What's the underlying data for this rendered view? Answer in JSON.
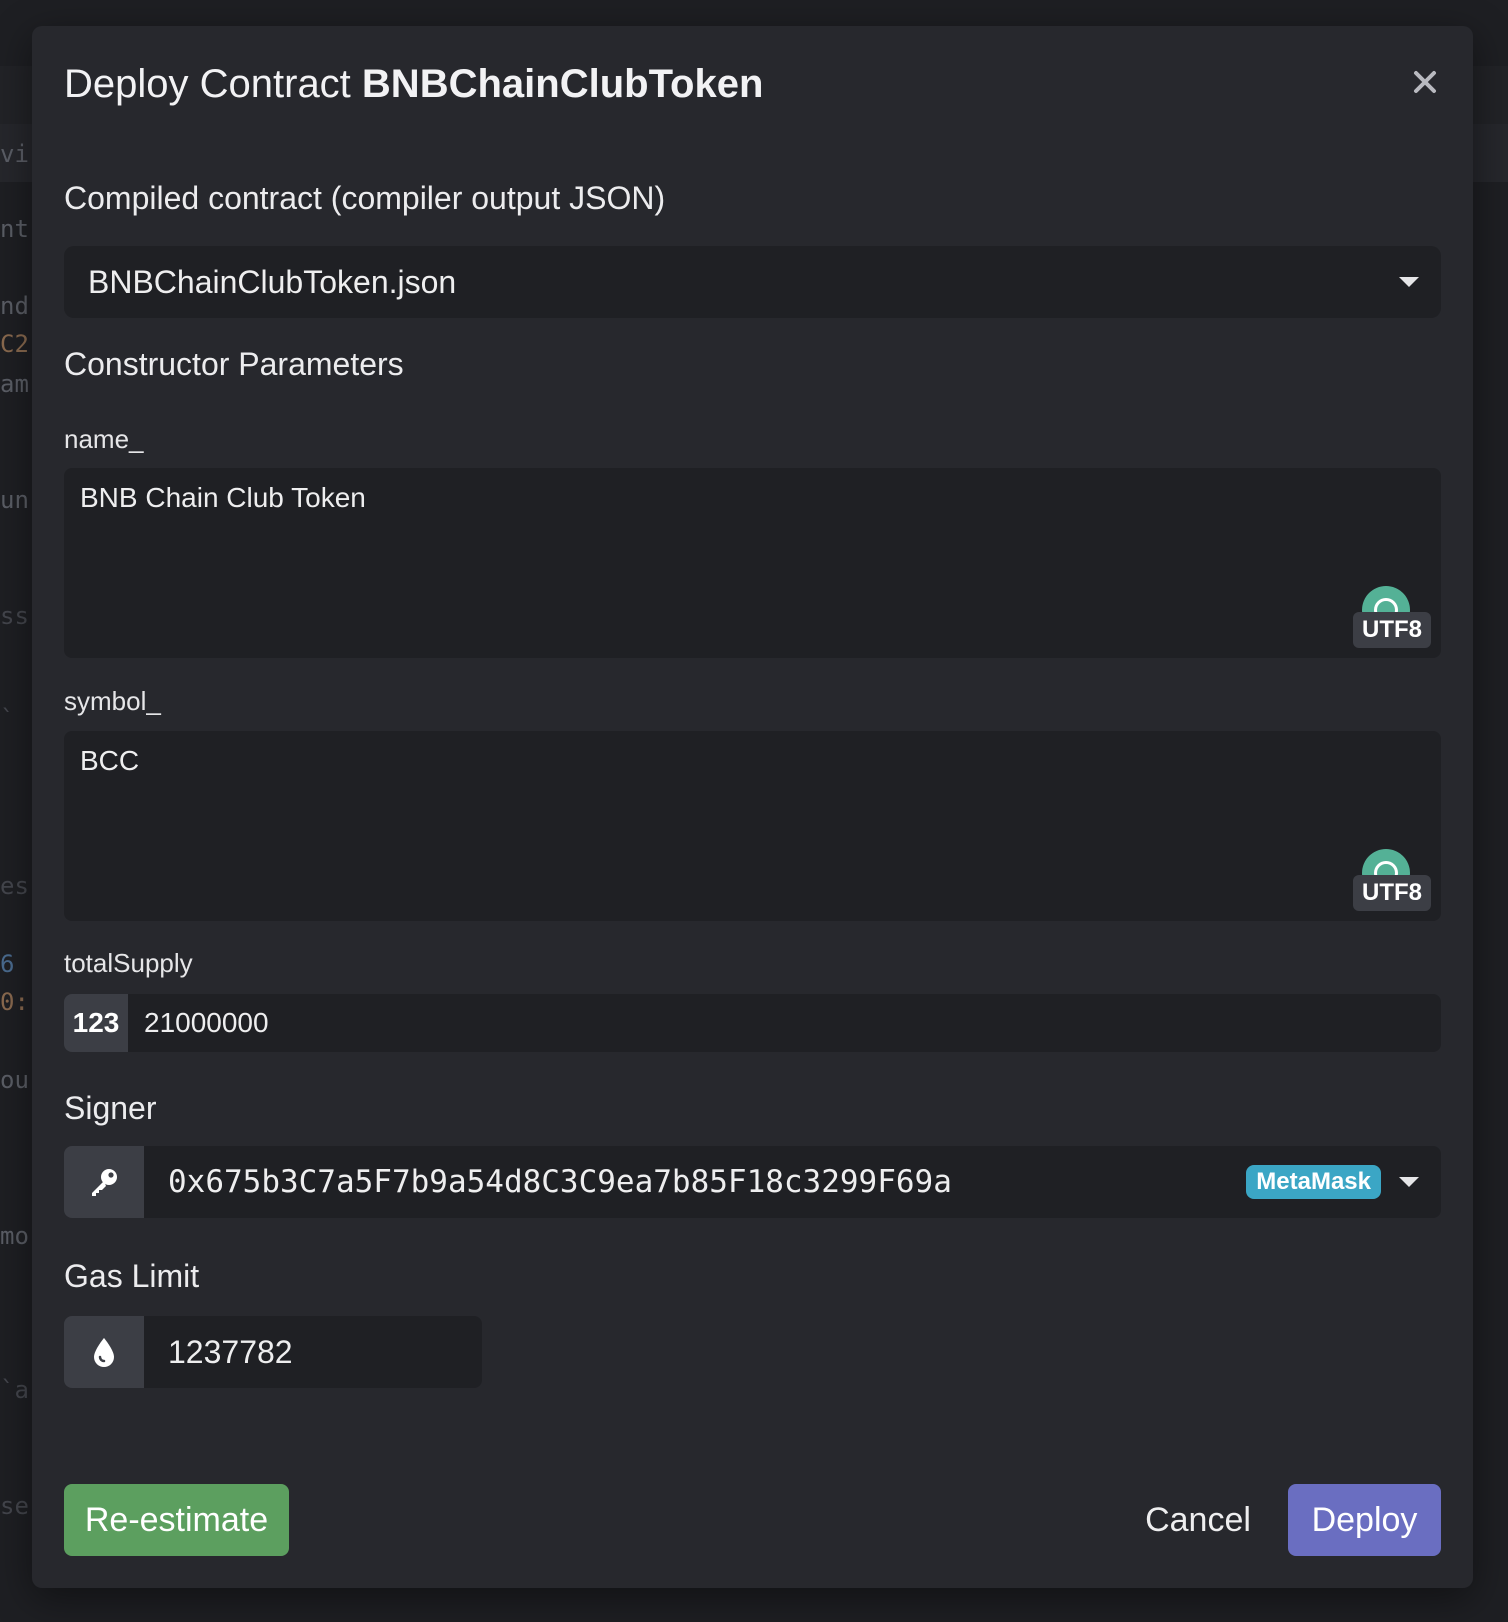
{
  "background": {
    "code_fragments": [
      "vir",
      "nt",
      "nd",
      "C2",
      "am",
      "un",
      "ss",
      "`",
      "es",
      "6",
      "0:",
      "ou",
      "mo",
      "`a",
      "se"
    ]
  },
  "dialog": {
    "title_prefix": "Deploy Contract",
    "title_contract": "BNBChainClubToken",
    "close_icon": "close-icon",
    "compiled": {
      "label": "Compiled contract (compiler output JSON)",
      "selected": "BNBChainClubToken.json"
    },
    "constructor": {
      "heading": "Constructor Parameters",
      "params": [
        {
          "label": "name_",
          "value": "BNB Chain Club Token",
          "encoding": "UTF8"
        },
        {
          "label": "symbol_",
          "value": "BCC",
          "encoding": "UTF8"
        }
      ],
      "total_supply": {
        "label": "totalSupply",
        "type_tag": "123",
        "value": "21000000"
      }
    },
    "signer": {
      "label": "Signer",
      "icon": "key-icon",
      "address": "0x675b3C7a5F7b9a54d8C3C9ea7b85F18c3299F69a",
      "wallet": "MetaMask"
    },
    "gas": {
      "label": "Gas Limit",
      "icon": "drop-icon",
      "value": "1237782"
    },
    "buttons": {
      "reestimate": "Re-estimate",
      "cancel": "Cancel",
      "deploy": "Deploy"
    },
    "colors": {
      "modal_bg": "#27282d",
      "input_bg": "#1f2024",
      "reestimate": "#5c9f5f",
      "deploy": "#6a6ec1",
      "metamask_badge": "#3ba6c5",
      "utf8_indicator": "#54b196"
    }
  }
}
